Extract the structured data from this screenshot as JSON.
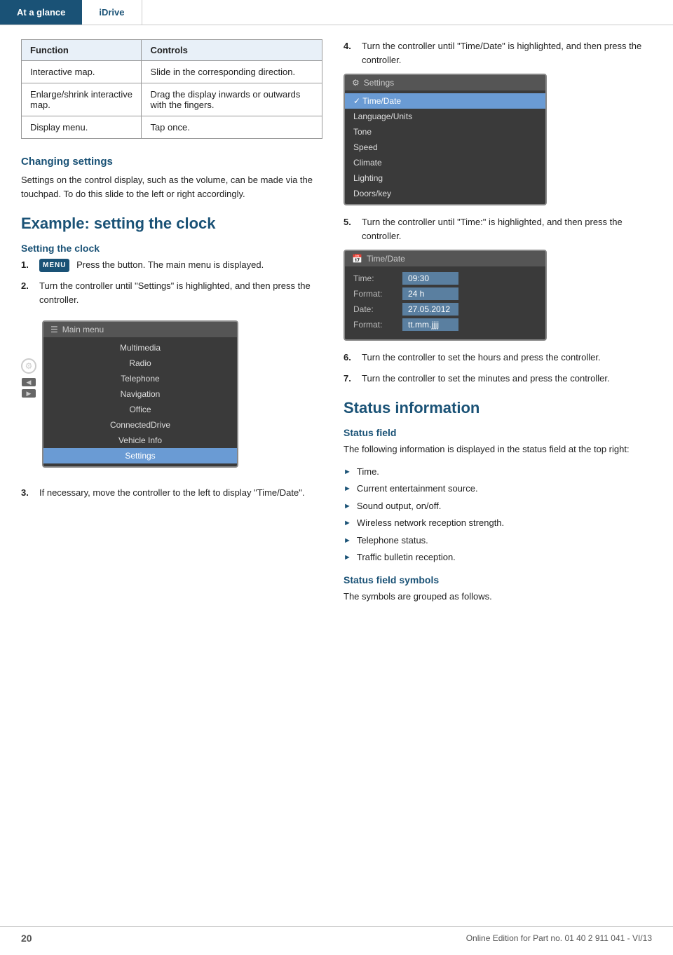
{
  "nav": {
    "tab1": "At a glance",
    "tab2": "iDrive"
  },
  "table": {
    "col1_header": "Function",
    "col2_header": "Controls",
    "rows": [
      {
        "function": "Interactive map.",
        "controls": "Slide in the corresponding direction."
      },
      {
        "function": "Enlarge/shrink interactive map.",
        "controls": "Drag the display inwards or outwards with the fingers."
      },
      {
        "function": "Display menu.",
        "controls": "Tap once."
      }
    ]
  },
  "changing_settings": {
    "heading": "Changing settings",
    "body": "Settings on the control display, such as the volume, can be made via the touchpad. To do this slide to the left or right accordingly."
  },
  "example_section": {
    "heading": "Example: setting the clock",
    "sub_heading": "Setting the clock",
    "steps": [
      {
        "number": "1.",
        "text": "Press the button. The main menu is displayed.",
        "has_button": true,
        "button_label": "MENU"
      },
      {
        "number": "2.",
        "text": "Turn the controller until \"Settings\" is highlighted, and then press the controller."
      },
      {
        "number": "3.",
        "text": "If necessary, move the controller to the left to display \"Time/Date\"."
      }
    ],
    "main_menu_screen": {
      "title": "Main menu",
      "items": [
        "Multimedia",
        "Radio",
        "Telephone",
        "Navigation",
        "Office",
        "ConnectedDrive",
        "Vehicle Info",
        "Settings"
      ],
      "highlighted": "Settings"
    }
  },
  "right_col": {
    "steps": [
      {
        "number": "4.",
        "text": "Turn the controller until \"Time/Date\" is highlighted, and then press the controller."
      },
      {
        "number": "5.",
        "text": "Turn the controller until \"Time:\" is highlighted, and then press the controller."
      },
      {
        "number": "6.",
        "text": "Turn the controller to set the hours and press the controller."
      },
      {
        "number": "7.",
        "text": "Turn the controller to set the minutes and press the controller."
      }
    ],
    "settings_screen": {
      "title": "Settings",
      "items": [
        "Time/Date",
        "Language/Units",
        "Tone",
        "Speed",
        "Climate",
        "Lighting",
        "Doors/key"
      ],
      "highlighted": "Time/Date"
    },
    "timedate_screen": {
      "title": "Time/Date",
      "rows": [
        {
          "label": "Time:",
          "value": "09:30"
        },
        {
          "label": "Format:",
          "value": "24 h"
        },
        {
          "label": "Date:",
          "value": "27.05.2012"
        },
        {
          "label": "Format:",
          "value": "tt.mm.jjjj"
        }
      ],
      "highlighted_row": "Time:"
    }
  },
  "status_information": {
    "heading": "Status information",
    "status_field": {
      "heading": "Status field",
      "body": "The following information is displayed in the status field at the top right:",
      "items": [
        "Time.",
        "Current entertainment source.",
        "Sound output, on/off.",
        "Wireless network reception strength.",
        "Telephone status.",
        "Traffic bulletin reception."
      ]
    },
    "status_field_symbols": {
      "heading": "Status field symbols",
      "body": "The symbols are grouped as follows."
    }
  },
  "footer": {
    "page_number": "20",
    "edition": "Online Edition for Part no. 01 40 2 911 041 - VI/13"
  }
}
